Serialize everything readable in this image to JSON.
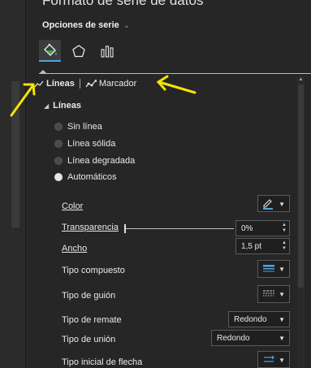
{
  "panel": {
    "title": "Formato de serie de datos",
    "series_options_label": "Opciones de serie",
    "icons": [
      "fill-line-icon",
      "pentagon-effects-icon",
      "bar-chart-icon"
    ]
  },
  "subtabs": {
    "lines": "Líneas",
    "marker": "Marcador"
  },
  "section": {
    "title": "Líneas"
  },
  "line_types": [
    {
      "label": "Sin línea",
      "checked": false
    },
    {
      "label": "Línea sólida",
      "checked": false
    },
    {
      "label": "Línea degradada",
      "checked": false
    },
    {
      "label": "Automáticos",
      "checked": true
    }
  ],
  "properties": {
    "color": {
      "label": "Color"
    },
    "transparency": {
      "label": "Transparencia",
      "value": "0%",
      "level": 0
    },
    "width": {
      "label": "Ancho",
      "value": "1,5 pt"
    },
    "compound_type": {
      "label": "Tipo compuesto"
    },
    "dash_type": {
      "label": "Tipo de guión"
    },
    "cap_type": {
      "label": "Tipo de remate",
      "value": "Redondo"
    },
    "join_type": {
      "label": "Tipo de unión",
      "value": "Redondo"
    },
    "begin_arrow": {
      "label": "Tipo inicial de flecha"
    }
  },
  "colors": {
    "accent": "#4fa3e0",
    "annotation_arrow": "#f5e400"
  }
}
